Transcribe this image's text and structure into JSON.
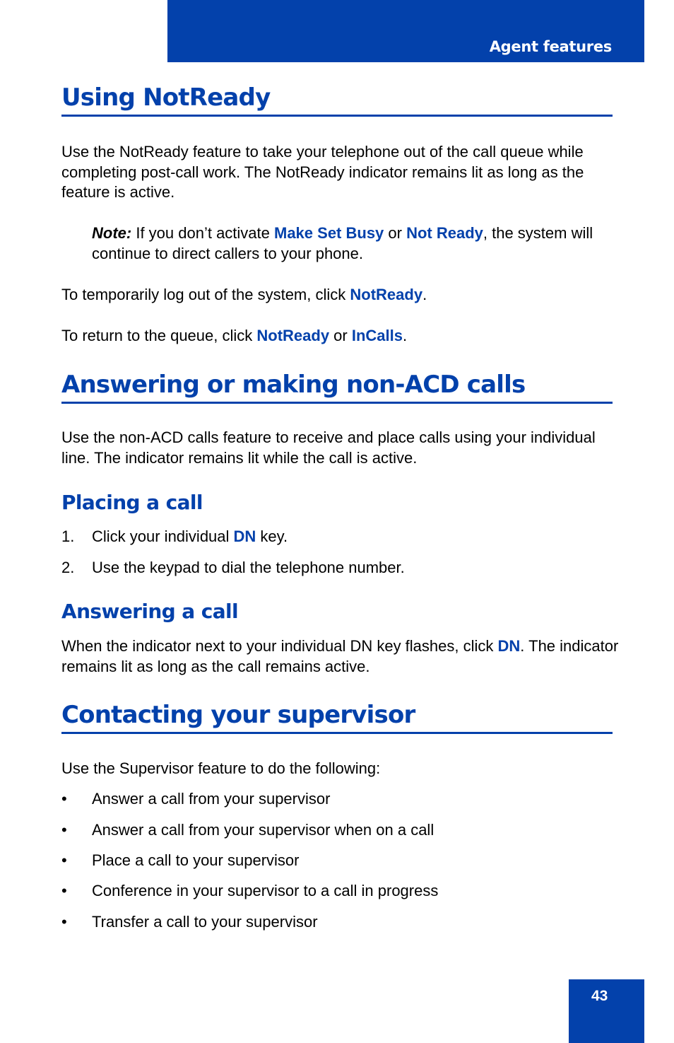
{
  "header": {
    "section_title": "Agent features"
  },
  "sections": {
    "notready": {
      "title": "Using NotReady",
      "intro": "Use the NotReady feature to take your telephone out of the call queue while completing post-call work. The NotReady indicator remains lit as long as the feature is active.",
      "note": {
        "label": "Note:",
        "t1": " If you don’t activate ",
        "k1": "Make Set Busy",
        "t2": " or ",
        "k2": "Not Ready",
        "t3": ", the system will continue to direct callers to your phone."
      },
      "logout": {
        "t1": "To temporarily log out of the system, click ",
        "k1": "NotReady",
        "t2": "."
      },
      "return": {
        "t1": "To return to the queue, click ",
        "k1": "NotReady",
        "t2": " or ",
        "k2": "InCalls",
        "t3": "."
      }
    },
    "nonacd": {
      "title": "Answering or making non-ACD calls",
      "intro": "Use the non-ACD calls feature to receive and place calls using your individual line. The indicator remains lit while the call is active.",
      "placing": {
        "title": "Placing a call",
        "steps": [
          {
            "num": "1.",
            "t1": "Click your individual ",
            "k1": "DN",
            "t2": " key."
          },
          {
            "num": "2.",
            "t1": "Use the keypad to dial the telephone number."
          }
        ]
      },
      "answering": {
        "title": "Answering a call",
        "t1": "When the indicator next to your individual DN key flashes, click ",
        "k1": "DN",
        "t2": ". The indicator remains lit as long as the call remains active."
      }
    },
    "supervisor": {
      "title": "Contacting your supervisor",
      "intro": "Use the Supervisor feature to do the following:",
      "bullet": "•",
      "items": [
        "Answer a call from your supervisor",
        "Answer a call from your supervisor when on a call",
        "Place a call to your supervisor",
        "Conference in your supervisor to a call in progress",
        "Transfer a call to your supervisor"
      ]
    }
  },
  "footer": {
    "page_number": "43"
  },
  "colors": {
    "accent": "#0341ab",
    "text": "#000000",
    "background": "#ffffff"
  }
}
